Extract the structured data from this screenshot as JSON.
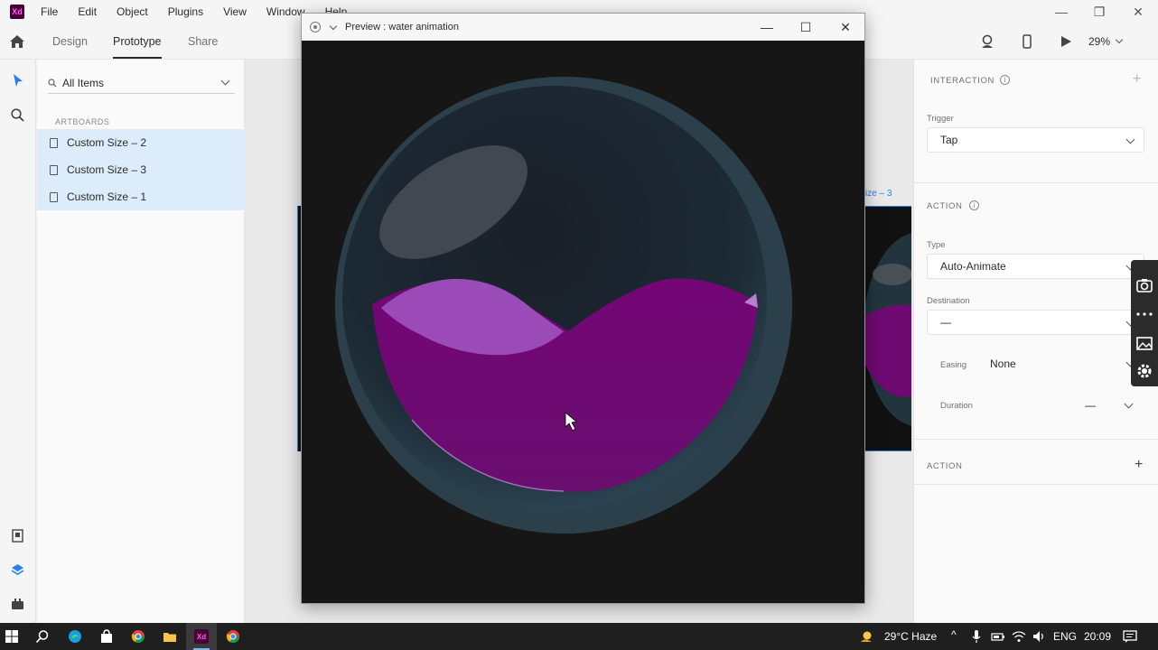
{
  "app": {
    "logo_text": "Xd",
    "menu": [
      "File",
      "Edit",
      "Object",
      "Plugins",
      "View",
      "Window",
      "Help"
    ]
  },
  "toolbar": {
    "tabs": [
      "Design",
      "Prototype",
      "Share"
    ],
    "active_tab": "Prototype",
    "zoom": "29%"
  },
  "layers": {
    "search_label": "All Items",
    "section": "ARTBOARDS",
    "items": [
      "Custom Size – 2",
      "Custom Size – 3",
      "Custom Size – 1"
    ]
  },
  "canvas": {
    "artboard_label": "ize – 3"
  },
  "preview": {
    "title": "Preview : water animation"
  },
  "inspector": {
    "interaction_header": "INTERACTION",
    "trigger_label": "Trigger",
    "trigger_value": "Tap",
    "action_header": "ACTION",
    "type_label": "Type",
    "type_value": "Auto-Animate",
    "destination_label": "Destination",
    "destination_value": "—",
    "easing_label": "Easing",
    "easing_value": "None",
    "duration_label": "Duration",
    "duration_value": "—",
    "action2_header": "ACTION"
  },
  "taskbar": {
    "weather": "29°C  Haze",
    "language": "ENG",
    "time": "20:09"
  },
  "colors": {
    "accent_blue": "#2680eb",
    "selection": "#dcecfa",
    "liquid": "#6e0a72",
    "liquid_light": "#9648b4",
    "sphere": "#2a3e4a"
  }
}
